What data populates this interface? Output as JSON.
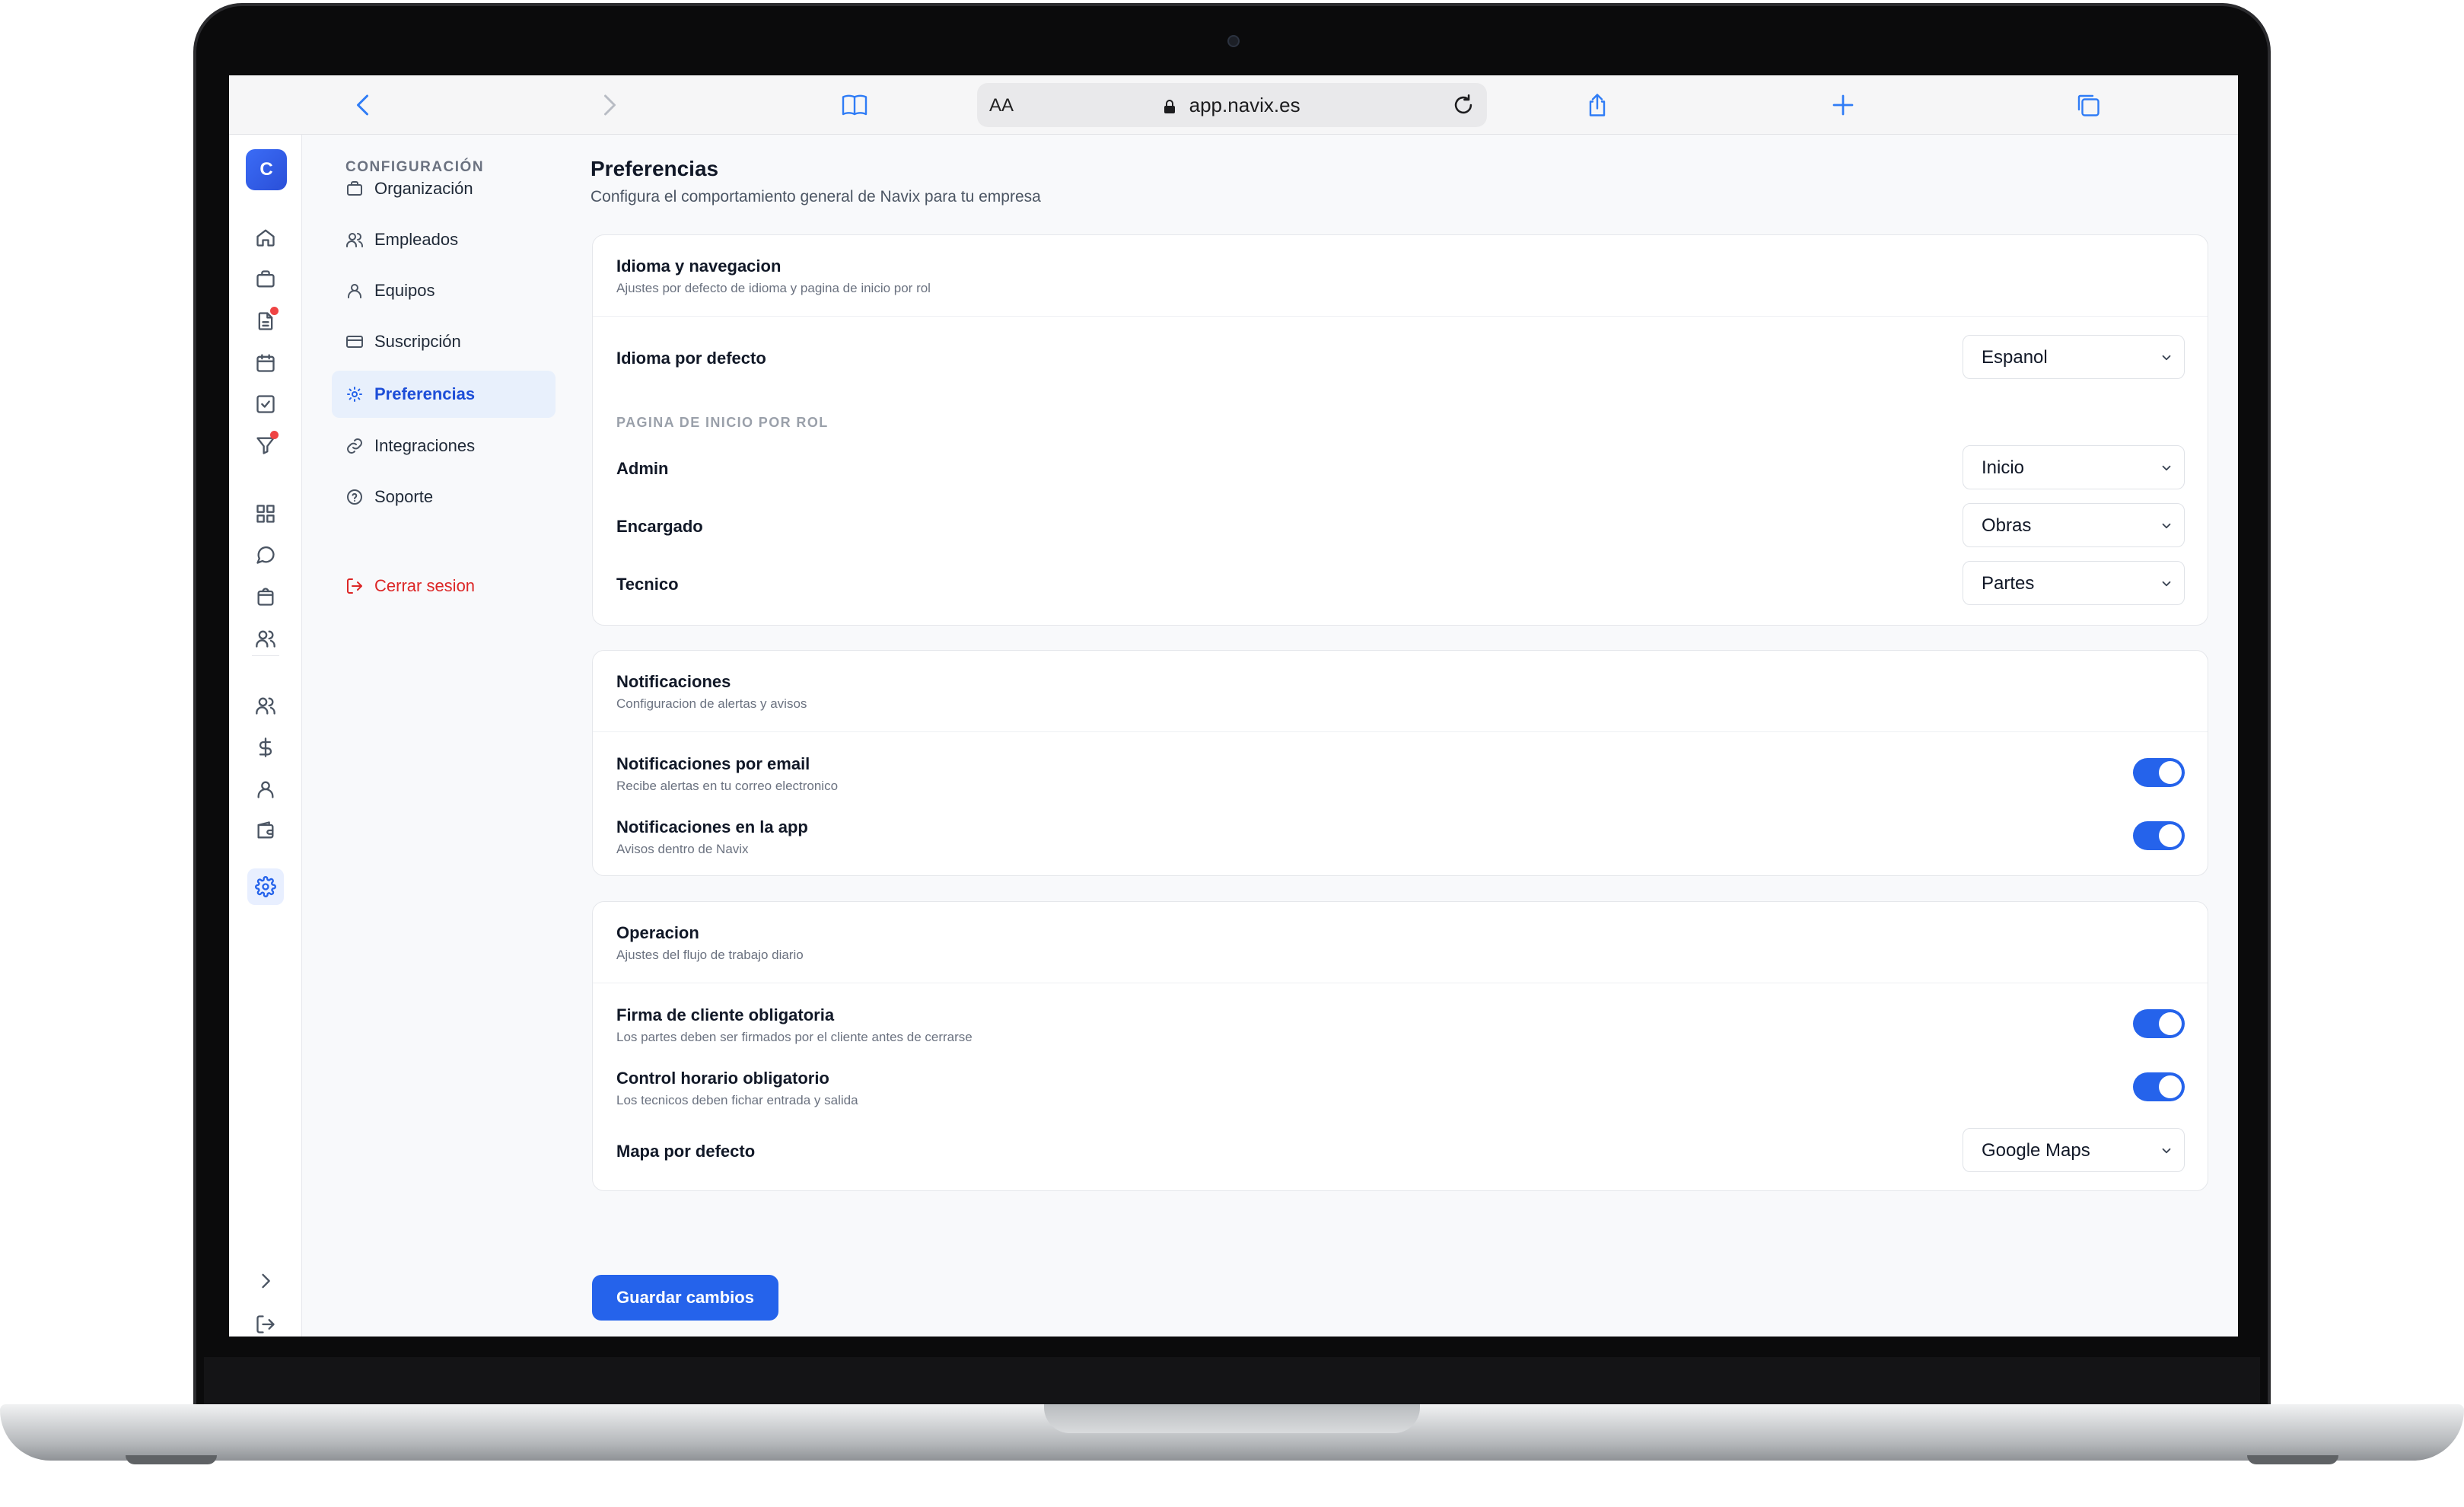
{
  "browser": {
    "text_size_label": "AA",
    "url": "app.navix.es"
  },
  "rail": {
    "avatar_initial": "C"
  },
  "settings_nav": {
    "title": "CONFIGURACIÓN",
    "items": [
      {
        "label": "Organización",
        "icon": "briefcase-icon"
      },
      {
        "label": "Empleados",
        "icon": "users-icon"
      },
      {
        "label": "Equipos",
        "icon": "user-icon"
      },
      {
        "label": "Suscripción",
        "icon": "credit-card-icon"
      },
      {
        "label": "Preferencias",
        "icon": "sun-icon",
        "active": true
      },
      {
        "label": "Integraciones",
        "icon": "link-icon"
      },
      {
        "label": "Soporte",
        "icon": "help-circle-icon"
      }
    ],
    "logout_label": "Cerrar sesion"
  },
  "page": {
    "title": "Preferencias",
    "subtitle": "Configura el comportamiento general de Navix para tu empresa"
  },
  "language_card": {
    "title": "Idioma y navegacion",
    "description": "Ajustes por defecto de idioma y pagina de inicio por rol",
    "default_language_label": "Idioma por defecto",
    "default_language_value": "Espanol",
    "section_label": "PAGINA DE INICIO POR ROL",
    "roles": [
      {
        "label": "Admin",
        "value": "Inicio"
      },
      {
        "label": "Encargado",
        "value": "Obras"
      },
      {
        "label": "Tecnico",
        "value": "Partes"
      }
    ]
  },
  "notifications_card": {
    "title": "Notificaciones",
    "description": "Configuracion de alertas y avisos",
    "items": [
      {
        "label": "Notificaciones por email",
        "description": "Recibe alertas en tu correo electronico",
        "enabled": true
      },
      {
        "label": "Notificaciones en la app",
        "description": "Avisos dentro de Navix",
        "enabled": true
      }
    ]
  },
  "operation_card": {
    "title": "Operacion",
    "description": "Ajustes del flujo de trabajo diario",
    "items": [
      {
        "label": "Firma de cliente obligatoria",
        "description": "Los partes deben ser firmados por el cliente antes de cerrarse",
        "enabled": true
      },
      {
        "label": "Control horario obligatorio",
        "description": "Los tecnicos deben fichar entrada y salida",
        "enabled": true
      }
    ],
    "default_map_label": "Mapa por defecto",
    "default_map_value": "Google Maps"
  },
  "actions": {
    "save_label": "Guardar cambios"
  },
  "colors": {
    "accent": "#2563eb",
    "danger": "#dc2626",
    "notification_dot": "#ef4444"
  }
}
